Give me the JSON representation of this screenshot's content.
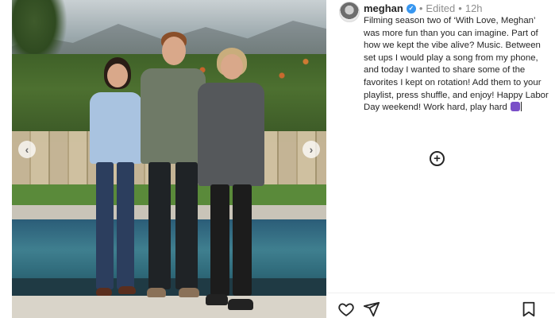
{
  "post": {
    "username": "meghan",
    "verified_icon": "verified-badge-icon",
    "edited": "Edited",
    "separator": "•",
    "time": "12h",
    "caption": "Filming season two of ‘With Love, Meghan’ was more fun than you can imagine. Part of how we kept the vibe alive? Music. Between set ups I would play a song from my phone, and today I wanted to share some of the favorites I kept on rotation! Add them to your playlist, press shuffle, and enjoy! Happy Labor Day weekend! Work hard, play hard",
    "caption_emoji": "purple-emoji-icon"
  },
  "photo_nav": {
    "prev_glyph": "‹",
    "next_glyph": "›"
  },
  "add_button": {
    "glyph": "+",
    "icon": "plus-circle-icon"
  },
  "actions": {
    "like_icon": "heart-icon",
    "share_icon": "send-icon",
    "save_icon": "bookmark-icon"
  },
  "colors": {
    "text": "#262626",
    "muted": "#8e8e8e",
    "verified": "#3897f0"
  }
}
